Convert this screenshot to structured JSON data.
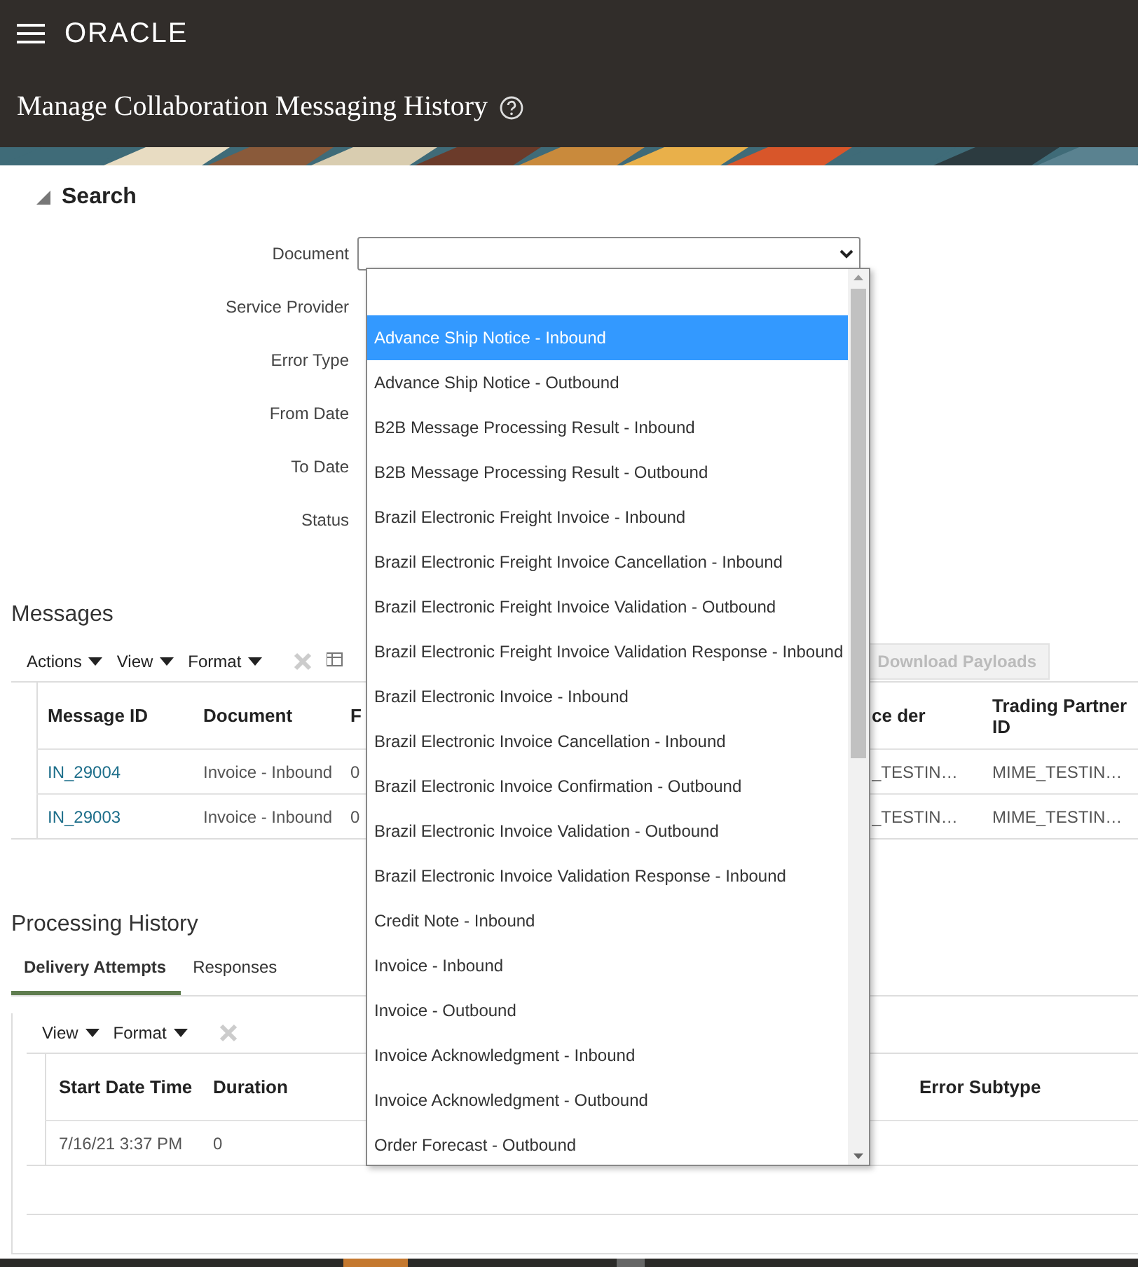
{
  "header": {
    "brand": "ORACLE"
  },
  "page_title": "Manage Collaboration Messaging History",
  "search": {
    "title": "Search",
    "expanded": true,
    "fields": [
      {
        "label": "Document"
      },
      {
        "label": "Service Provider"
      },
      {
        "label": "Error Type"
      },
      {
        "label": "From Date"
      },
      {
        "label": "To Date"
      },
      {
        "label": "Status"
      }
    ],
    "document_dropdown": {
      "options": [
        {
          "label": "Advance Ship Notice - Inbound",
          "selected": true
        },
        {
          "label": "Advance Ship Notice - Outbound",
          "selected": false
        },
        {
          "label": "B2B Message Processing Result - Inbound",
          "selected": false
        },
        {
          "label": "B2B Message Processing Result - Outbound",
          "selected": false
        },
        {
          "label": "Brazil Electronic Freight Invoice - Inbound",
          "selected": false
        },
        {
          "label": "Brazil Electronic Freight Invoice Cancellation - Inbound",
          "selected": false
        },
        {
          "label": "Brazil Electronic Freight Invoice Validation - Outbound",
          "selected": false
        },
        {
          "label": "Brazil Electronic Freight Invoice Validation Response - Inbound",
          "selected": false
        },
        {
          "label": "Brazil Electronic Invoice - Inbound",
          "selected": false
        },
        {
          "label": "Brazil Electronic Invoice Cancellation - Inbound",
          "selected": false
        },
        {
          "label": "Brazil Electronic Invoice Confirmation - Outbound",
          "selected": false
        },
        {
          "label": "Brazil Electronic Invoice Validation - Outbound",
          "selected": false
        },
        {
          "label": "Brazil Electronic Invoice Validation Response - Inbound",
          "selected": false
        },
        {
          "label": "Credit Note - Inbound",
          "selected": false
        },
        {
          "label": "Invoice - Inbound",
          "selected": false
        },
        {
          "label": "Invoice - Outbound",
          "selected": false
        },
        {
          "label": "Invoice Acknowledgment - Inbound",
          "selected": false
        },
        {
          "label": "Invoice Acknowledgment - Outbound",
          "selected": false
        },
        {
          "label": "Order Forecast - Outbound",
          "selected": false
        }
      ]
    }
  },
  "messages": {
    "title": "Messages",
    "menus": [
      "Actions",
      "View",
      "Format"
    ],
    "download_button": {
      "label": "Download Payloads",
      "disabled": true
    },
    "columns": [
      "Message ID",
      "Document",
      "F",
      "ce der",
      "Trading Partner ID"
    ],
    "rows": [
      [
        "IN_29004",
        "Invoice - Inbound",
        "0",
        "_TESTIN…",
        "MIME_TESTIN…"
      ],
      [
        "IN_29003",
        "Invoice - Inbound",
        "0",
        "_TESTIN…",
        "MIME_TESTIN…"
      ]
    ]
  },
  "processing_history": {
    "title": "Processing History",
    "tabs": [
      {
        "label": "Delivery Attempts",
        "selected": true
      },
      {
        "label": "Responses",
        "selected": false
      }
    ],
    "menus": [
      "View",
      "Format"
    ],
    "columns": [
      "Start Date Time",
      "Duration",
      "Error Subtype"
    ],
    "rows": [
      [
        "7/16/21 3:37 PM",
        "0",
        ""
      ]
    ]
  }
}
